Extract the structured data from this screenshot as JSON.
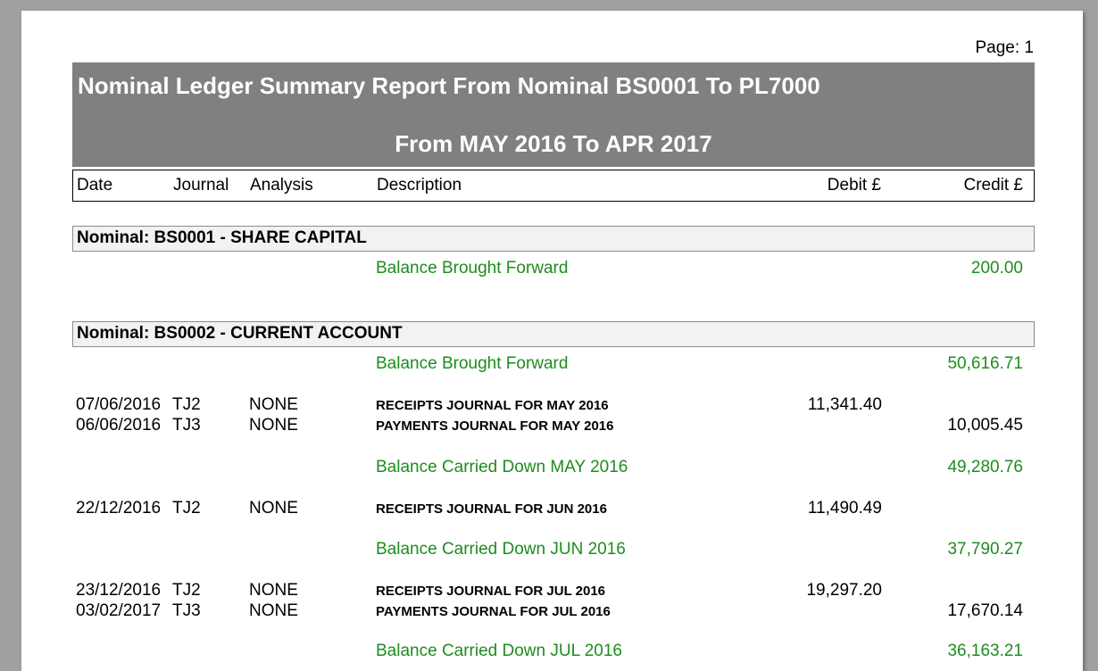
{
  "page_label": "Page: 1",
  "report": {
    "title": "Nominal Ledger Summary Report From Nominal BS0001 To PL7000",
    "period": "From MAY 2016 To APR 2017"
  },
  "columns": {
    "date": "Date",
    "journal": "Journal",
    "analysis": "Analysis",
    "description": "Description",
    "debit": "Debit £",
    "credit": "Credit £"
  },
  "nominals": [
    {
      "heading": "Nominal: BS0001 - SHARE CAPITAL",
      "bf_label": "Balance Brought Forward",
      "bf_value": "200.00"
    },
    {
      "heading": "Nominal: BS0002 - CURRENT ACCOUNT",
      "bf_label": "Balance Brought Forward",
      "bf_value": "50,616.71",
      "entries": [
        {
          "date": "07/06/2016",
          "journal": "TJ2",
          "analysis": "NONE",
          "description": "RECEIPTS JOURNAL FOR MAY 2016",
          "debit": "11,341.40",
          "credit": ""
        },
        {
          "date": "06/06/2016",
          "journal": "TJ3",
          "analysis": "NONE",
          "description": "PAYMENTS JOURNAL FOR MAY 2016",
          "debit": "",
          "credit": "10,005.45"
        },
        {
          "date": "22/12/2016",
          "journal": "TJ2",
          "analysis": "NONE",
          "description": "RECEIPTS JOURNAL FOR JUN 2016",
          "debit": "11,490.49",
          "credit": ""
        },
        {
          "date": "23/12/2016",
          "journal": "TJ2",
          "analysis": "NONE",
          "description": "RECEIPTS JOURNAL FOR JUL 2016",
          "debit": "19,297.20",
          "credit": ""
        },
        {
          "date": "03/02/2017",
          "journal": "TJ3",
          "analysis": "NONE",
          "description": "PAYMENTS JOURNAL FOR JUL 2016",
          "debit": "",
          "credit": "17,670.14"
        }
      ],
      "balances_cd": [
        {
          "label": "Balance Carried Down MAY 2016",
          "value": "49,280.76"
        },
        {
          "label": "Balance Carried Down JUN 2016",
          "value": "37,790.27"
        },
        {
          "label": "Balance Carried Down JUL 2016",
          "value": "36,163.21"
        }
      ]
    }
  ],
  "colors": {
    "title_band": "#808080",
    "balance_text": "#1e8c1e",
    "section_fill": "#f2f2f2"
  }
}
